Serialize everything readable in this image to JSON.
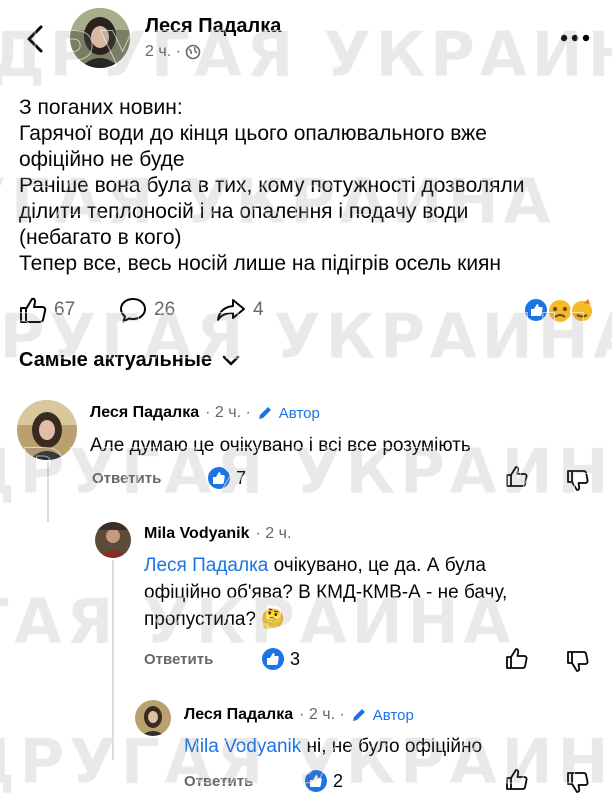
{
  "header": {
    "author": "Леся Падалка",
    "time": "2 ч. ·"
  },
  "post": {
    "lines": [
      "З поганих новин:",
      "Гарячої води до кінця цього опалювального вже",
      "офіційно не буде",
      "Раніше вона була в тих, кому потужності дозволяли",
      "ділити теплоносій і на опалення і подачу води",
      "(небагато в кого)",
      "Тепер все, весь носій лише на підігрів осель киян"
    ],
    "likes": "67",
    "comments": "26",
    "shares": "4"
  },
  "sort": {
    "label": "Самые актуальные"
  },
  "comments": [
    {
      "author": "Леся Падалка",
      "time": "· 2 ч. ·",
      "badge": "Автор",
      "text": "Але думаю це очікувано і всі все розуміють",
      "reply_label": "Ответить",
      "likes": "7"
    },
    {
      "author": "Mila Vodyanik",
      "time": "· 2 ч.",
      "mention": "Леся Падалка",
      "text_1": " очікувано, це да. А була",
      "text_2": "офіційно об'ява? В КМД-КМВ-А - не бачу,",
      "text_3": "пропустила? 🤔",
      "reply_label": "Ответить",
      "likes": "3"
    },
    {
      "author": "Леся Падалка",
      "time": "· 2 ч. ·",
      "badge": "Автор",
      "mention": "Mila Vodyanik",
      "text": " ні, не було офіційно",
      "reply_label": "Ответить",
      "likes": "2"
    }
  ],
  "watermark": "ДРУГАЯ УКРАИНА",
  "colors": {
    "accent": "#1b74e4",
    "meta": "#65676b",
    "thread": "#d8dadf"
  }
}
